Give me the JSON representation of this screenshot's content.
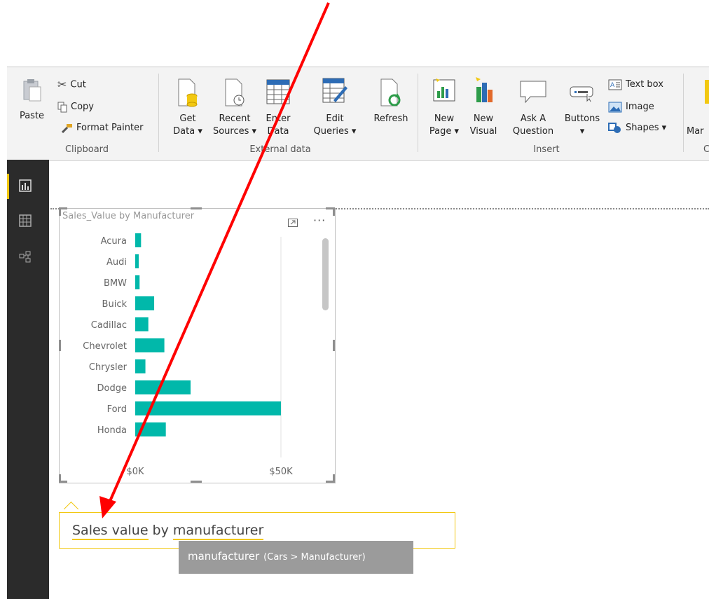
{
  "ribbon": {
    "clipboard": {
      "group_label": "Clipboard",
      "paste": "Paste",
      "cut": "Cut",
      "copy": "Copy",
      "format_painter": "Format Painter"
    },
    "external_data": {
      "group_label": "External data",
      "get_data_l1": "Get",
      "get_data_l2": "Data ▾",
      "recent_l1": "Recent",
      "recent_l2": "Sources ▾",
      "enter_l1": "Enter",
      "enter_l2": "Data",
      "edit_l1": "Edit",
      "edit_l2": "Queries ▾",
      "refresh": "Refresh"
    },
    "insert": {
      "group_label": "Insert",
      "new_page_l1": "New",
      "new_page_l2": "Page ▾",
      "new_visual_l1": "New",
      "new_visual_l2": "Visual",
      "ask_l1": "Ask A",
      "ask_l2": "Question",
      "buttons_l1": "Buttons",
      "buttons_l2": "▾",
      "text_box": "Text box",
      "image": "Image",
      "shapes": "Shapes ▾"
    },
    "cut_off": {
      "label_l2": "Mar",
      "group_label": "C"
    }
  },
  "visual": {
    "title": "Sales_Value by Manufacturer",
    "more": "···"
  },
  "chart_data": {
    "type": "bar",
    "orientation": "horizontal",
    "title": "Sales_Value by Manufacturer",
    "categories": [
      "Acura",
      "Audi",
      "BMW",
      "Buick",
      "Cadillac",
      "Chevrolet",
      "Chrysler",
      "Dodge",
      "Ford",
      "Honda"
    ],
    "values": [
      2000,
      1200,
      1500,
      6500,
      4500,
      10000,
      3500,
      19000,
      50000,
      10500
    ],
    "xlim": [
      0,
      55000
    ],
    "x_ticks": [
      0,
      50000
    ],
    "x_tick_labels": [
      "$0K",
      "$50K"
    ],
    "bar_color": "#01b8aa",
    "grid": true
  },
  "qna": {
    "w1": "Sales value",
    "w2": " by ",
    "w3": "manufacturer",
    "suggestion_term": "manufacturer",
    "suggestion_path": "(Cars > Manufacturer)"
  },
  "colors": {
    "accent": "#f2c811",
    "bar": "#01b8aa",
    "annotation_arrow": "#ff0000"
  }
}
